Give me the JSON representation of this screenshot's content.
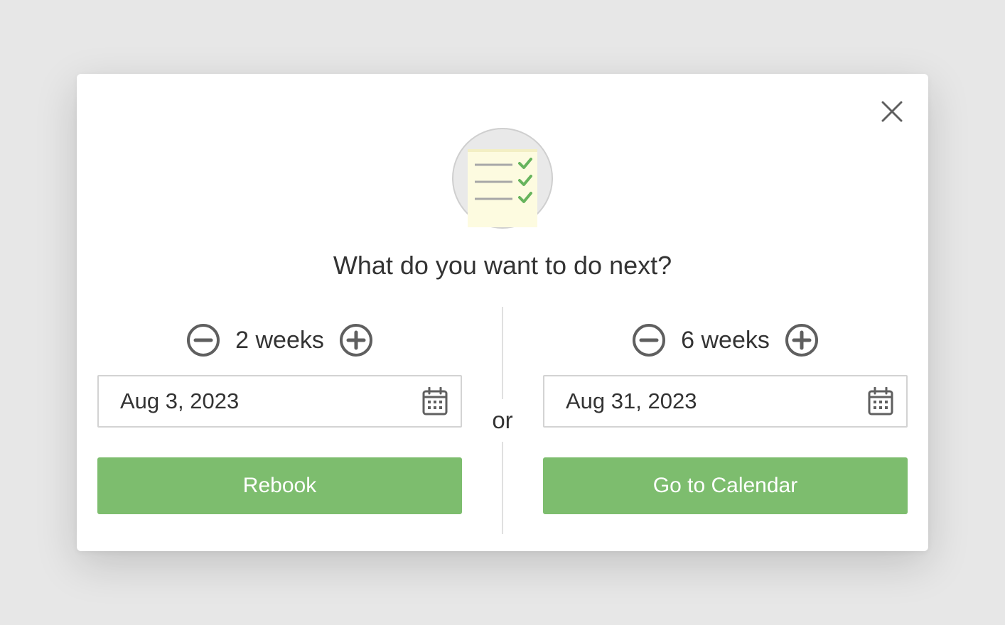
{
  "dialog": {
    "title": "What do you want to do next?",
    "close_icon": "close-icon",
    "illustration_icon": "checklist-icon",
    "separator": "or"
  },
  "left": {
    "interval": "2 weeks",
    "date": "Aug 3, 2023",
    "button": "Rebook"
  },
  "right": {
    "interval": "6 weeks",
    "date": "Aug 31, 2023",
    "button": "Go to Calendar"
  },
  "colors": {
    "accent": "#7dbd6e",
    "icon_gray": "#5f5f5f",
    "check_green": "#67b45d",
    "paper": "#fdfbe0"
  }
}
